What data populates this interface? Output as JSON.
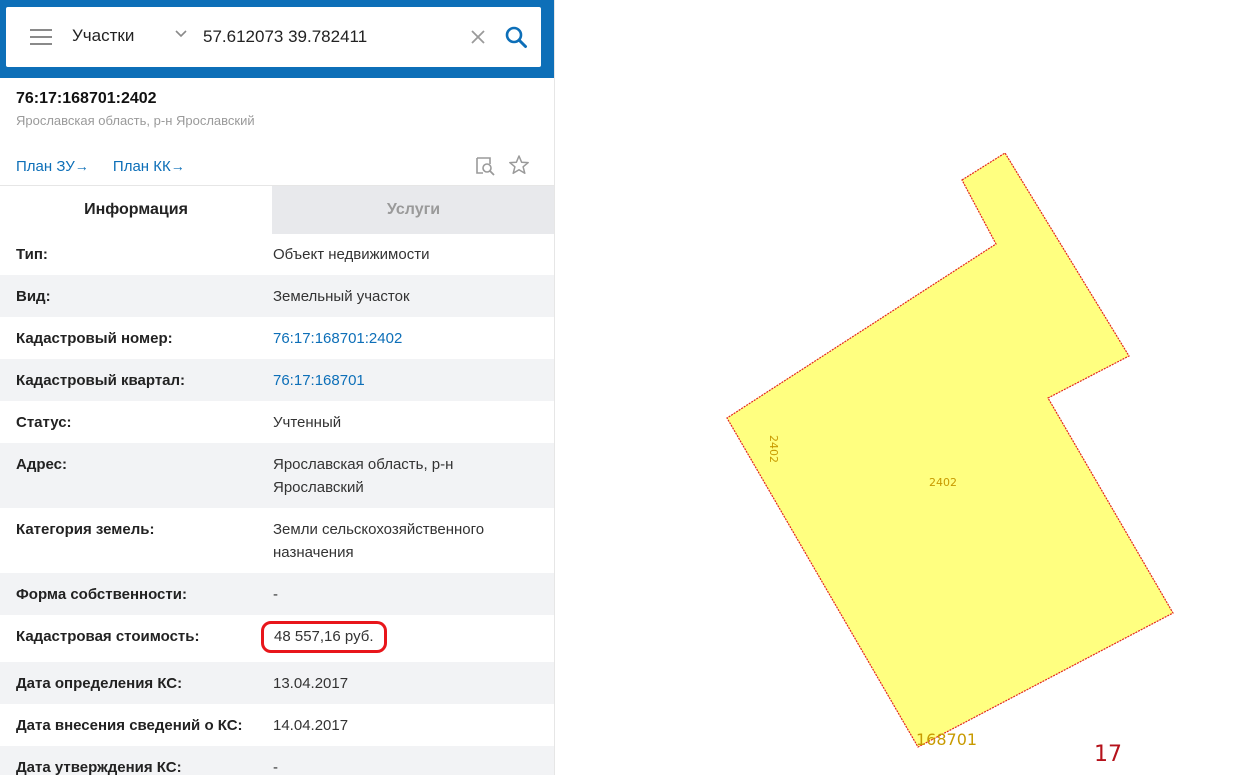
{
  "search": {
    "type": "Участки",
    "query": "57.612073 39.782411"
  },
  "object": {
    "title": "76:17:168701:2402",
    "subtitle": "Ярославская область, р-н Ярославский"
  },
  "links": {
    "plan_zu": "План ЗУ",
    "plan_kk": "План КК",
    "arrow": "→"
  },
  "tabs": {
    "info": "Информация",
    "services": "Услуги"
  },
  "rows": [
    {
      "label": "Тип:",
      "value": "Объект недвижимости"
    },
    {
      "label": "Вид:",
      "value": "Земельный участок"
    },
    {
      "label": "Кадастровый номер:",
      "value": "76:17:168701:2402"
    },
    {
      "label": "Кадастровый квартал:",
      "value": "76:17:168701"
    },
    {
      "label": "Статус:",
      "value": "Учтенный"
    },
    {
      "label": "Адрес:",
      "value": "Ярославская область, р-н Ярославский"
    },
    {
      "label": "Категория земель:",
      "value": "Земли сельскохозяйственного назначения"
    },
    {
      "label": "Форма собственности:",
      "value": "-"
    },
    {
      "label": "Кадастровая стоимость:",
      "value": "48 557,16 руб."
    },
    {
      "label": "Дата определения КС:",
      "value": "13.04.2017"
    },
    {
      "label": "Дата внесения сведений о КС:",
      "value": "14.04.2017"
    },
    {
      "label": "Дата утверждения КС:",
      "value": "-"
    }
  ],
  "map": {
    "parcel_label_center": "2402",
    "parcel_label_edge": "2402",
    "quarter_label": "168701",
    "zone_label": "17",
    "parcel_fill": "#ffff80",
    "parcel_stroke": "#e3261c",
    "label_color": "#c89a00",
    "zone_color": "#b5121b"
  },
  "colors": {
    "header": "#0d6fb8",
    "link": "#0d6fb8",
    "highlight": "#e8161b"
  }
}
